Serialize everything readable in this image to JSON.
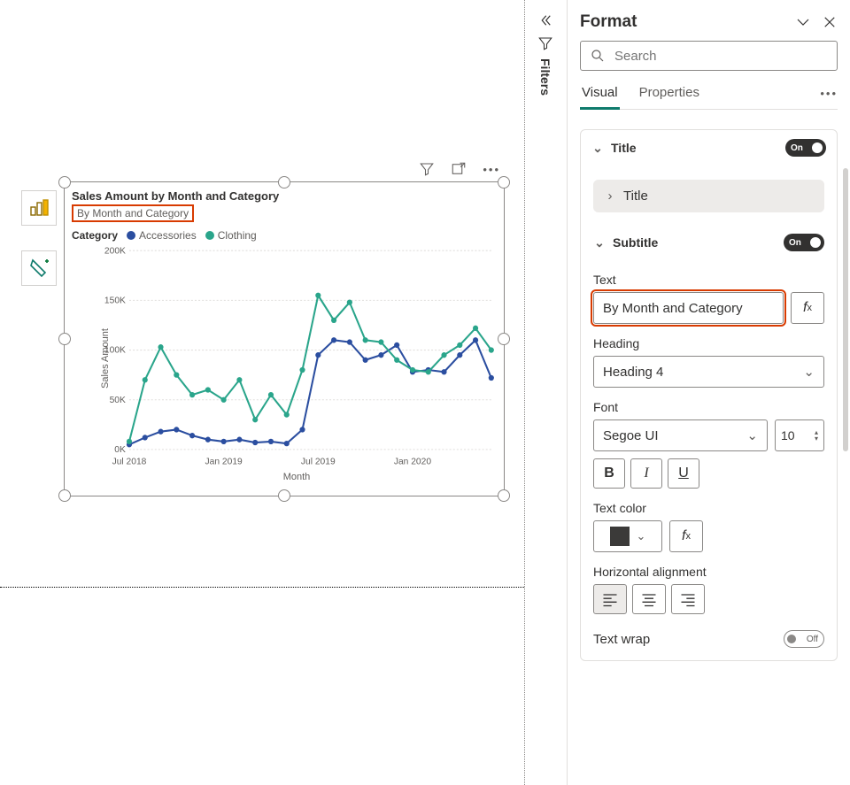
{
  "pane": {
    "title": "Format",
    "search_placeholder": "Search",
    "tabs": {
      "visual": "Visual",
      "properties": "Properties"
    },
    "title_card": {
      "label": "Title",
      "state": "On",
      "sub_label": "Title"
    },
    "subtitle_card": {
      "label": "Subtitle",
      "state": "On",
      "text_label": "Text",
      "text_value": "By Month and Category",
      "heading_label": "Heading",
      "heading_value": "Heading 4",
      "font_label": "Font",
      "font_value": "Segoe UI",
      "font_size": "10",
      "color_label": "Text color",
      "align_label": "Horizontal alignment",
      "wrap_label": "Text wrap",
      "wrap_state": "Off"
    }
  },
  "filters_label": "Filters",
  "visual": {
    "title": "Sales Amount by Month and Category",
    "subtitle": "By Month and Category",
    "legend_label": "Category",
    "legend_items": [
      {
        "name": "Accessories",
        "color": "#2b4ea0"
      },
      {
        "name": "Clothing",
        "color": "#2aa58b"
      }
    ],
    "ylabel": "Sales Amount",
    "xlabel": "Month"
  },
  "chart_data": {
    "type": "line",
    "title": "Sales Amount by Month and Category",
    "subtitle": "By Month and Category",
    "xlabel": "Month",
    "ylabel": "Sales Amount",
    "ylim": [
      0,
      200000
    ],
    "y_ticks": [
      0,
      50000,
      100000,
      150000,
      200000
    ],
    "y_tick_labels": [
      "0K",
      "50K",
      "100K",
      "150K",
      "200K"
    ],
    "x_tick_labels": [
      "Jul 2018",
      "Jan 2019",
      "Jul 2019",
      "Jan 2020"
    ],
    "x_tick_indices": [
      0,
      6,
      12,
      18
    ],
    "categories": [
      "Jul 2018",
      "Aug 2018",
      "Sep 2018",
      "Oct 2018",
      "Nov 2018",
      "Dec 2018",
      "Jan 2019",
      "Feb 2019",
      "Mar 2019",
      "Apr 2019",
      "May 2019",
      "Jun 2019",
      "Jul 2019",
      "Aug 2019",
      "Sep 2019",
      "Oct 2019",
      "Nov 2019",
      "Dec 2019",
      "Jan 2020",
      "Feb 2020",
      "Mar 2020",
      "Apr 2020",
      "May 2020",
      "Jun 2020"
    ],
    "series": [
      {
        "name": "Accessories",
        "color": "#2b4ea0",
        "values": [
          5000,
          12000,
          18000,
          20000,
          14000,
          10000,
          8000,
          10000,
          7000,
          8000,
          6000,
          20000,
          95000,
          110000,
          108000,
          90000,
          95000,
          105000,
          78000,
          80000,
          78000,
          95000,
          110000,
          72000
        ]
      },
      {
        "name": "Clothing",
        "color": "#2aa58b",
        "values": [
          8000,
          70000,
          103000,
          75000,
          55000,
          60000,
          50000,
          70000,
          30000,
          55000,
          35000,
          80000,
          155000,
          130000,
          148000,
          110000,
          108000,
          90000,
          80000,
          78000,
          95000,
          105000,
          122000,
          100000
        ]
      }
    ]
  }
}
